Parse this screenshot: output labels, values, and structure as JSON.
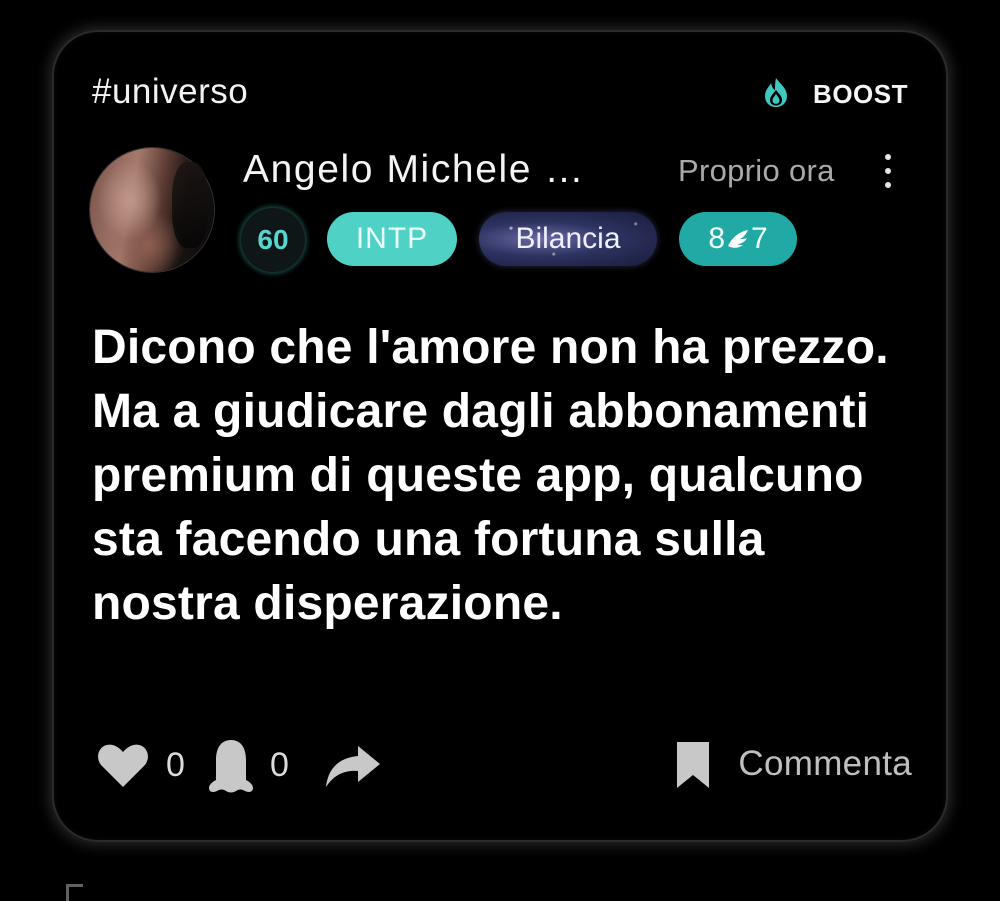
{
  "post": {
    "hashtag": "#universo",
    "boost_label": "BOOST",
    "author": {
      "name": "Angelo Michele …",
      "level": "60",
      "personality_type": "INTP",
      "zodiac": "Bilancia",
      "enneagram_left": "8",
      "enneagram_right": "7"
    },
    "timestamp": "Proprio ora",
    "text": "Dicono che l'amore non ha prezzo. Ma a giudicare dagli abbonamenti premium di queste app, qualcuno sta facendo una fortuna sulla nostra disperazione.",
    "actions": {
      "like_count": "0",
      "ghost_count": "0",
      "comment_label": "Commenta"
    }
  },
  "colors": {
    "background": "#000000",
    "accent_teal": "#4fd1c6",
    "enneagram_badge": "#21aaa5",
    "secondary_text": "#a9a9a9"
  },
  "icons": [
    "boost-flame-icon",
    "more-options-icon",
    "heart-icon",
    "ghost-icon",
    "share-icon",
    "bookmark-icon",
    "wing-icon"
  ]
}
